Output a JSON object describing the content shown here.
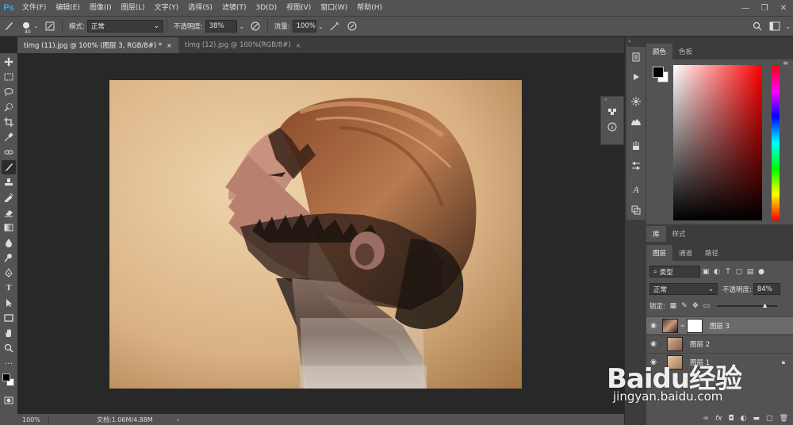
{
  "app": {
    "logo": "Ps"
  },
  "menu": [
    "文件(F)",
    "编辑(E)",
    "图像(I)",
    "图层(L)",
    "文字(Y)",
    "选择(S)",
    "滤镜(T)",
    "3D(D)",
    "视图(V)",
    "窗口(W)",
    "帮助(H)"
  ],
  "window_controls": {
    "minimize": "—",
    "restore": "❐",
    "close": "✕"
  },
  "options": {
    "brush_size": "40",
    "mode_label": "模式:",
    "mode_value": "正常",
    "opacity_label": "不透明度:",
    "opacity_value": "38%",
    "flow_label": "流量:",
    "flow_value": "100%"
  },
  "tabs": [
    {
      "label": "timg (11).jpg @ 100% (图层 3, RGB/8#) *",
      "close": "×"
    },
    {
      "label": "timg (12).jpg @ 100%(RGB/8#)",
      "close": "×"
    }
  ],
  "status": {
    "zoom": "100%",
    "doc": "文档:1.06M/4.88M",
    "arrow": "›"
  },
  "panels": {
    "color_tabs": [
      "颜色",
      "色板"
    ],
    "library_tabs": [
      "库",
      "样式"
    ],
    "layers_tabs": [
      "图层",
      "通道",
      "路径"
    ],
    "filter_kind": "类型",
    "blend_mode": "正常",
    "opacity_label": "不透明度:",
    "opacity_value": "84%",
    "lock_label": "锁定:"
  },
  "layers": [
    {
      "name": "图层 3",
      "selected": true
    },
    {
      "name": "图层 2",
      "selected": false
    },
    {
      "name": "图层 1",
      "selected": false
    }
  ],
  "colors": {
    "foreground": "#000000",
    "background": "#ffffff",
    "accent": "#31a8ff"
  },
  "watermark": {
    "logo": "Baidu经验",
    "url": "jingyan.baidu.com"
  }
}
